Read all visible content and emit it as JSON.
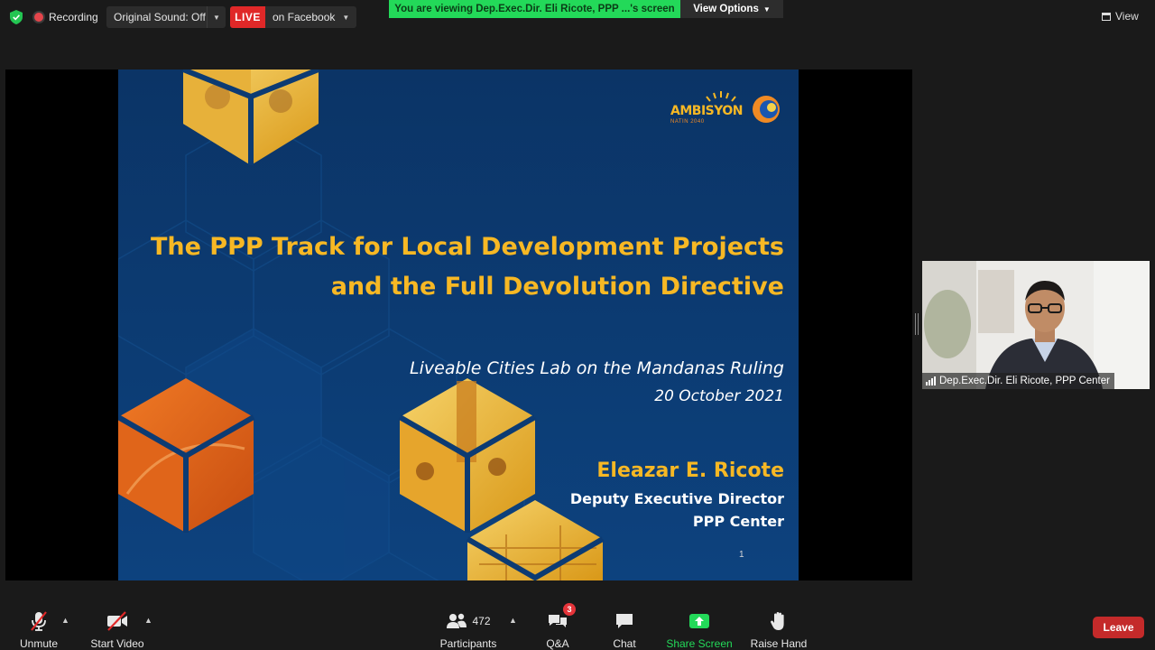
{
  "top_bar": {
    "recording_label": "Recording",
    "original_sound_label": "Original Sound: Off",
    "live_badge": "LIVE",
    "live_destination": "on Facebook",
    "viewing_banner": "You are viewing Dep.Exec.Dir. Eli Ricote, PPP ...'s screen",
    "view_options_label": "View Options",
    "view_label": "View"
  },
  "slide": {
    "title_line1": "The PPP Track for Local Development  Projects",
    "title_line2": "and the Full Devolution Directive",
    "subtitle": "Liveable Cities Lab on the Mandanas Ruling",
    "date": "20 October 2021",
    "presenter_name": "Eleazar E. Ricote",
    "presenter_role": "Deputy Executive Director",
    "presenter_org": "PPP Center",
    "page_number": "1",
    "logo_text": "AMBISYON",
    "logo_subtext": "NATIN 2040",
    "colors": {
      "background": "#0c3b73",
      "title": "#f7b824"
    }
  },
  "video": {
    "participant_name": "Dep.Exec.Dir. Eli Ricote, PPP Center"
  },
  "toolbar": {
    "unmute_label": "Unmute",
    "start_video_label": "Start Video",
    "participants_label": "Participants",
    "participants_count": "472",
    "qa_label": "Q&A",
    "qa_badge": "3",
    "chat_label": "Chat",
    "share_screen_label": "Share Screen",
    "raise_hand_label": "Raise Hand",
    "leave_label": "Leave",
    "colors": {
      "share_green": "#23d959",
      "leave_red": "#c42a2a"
    }
  }
}
